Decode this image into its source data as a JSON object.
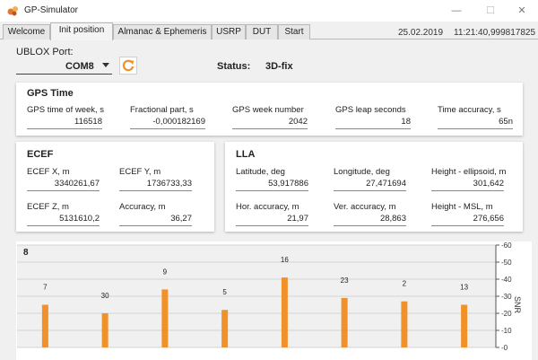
{
  "window": {
    "title": "GP-Simulator",
    "minimize": "—",
    "maximize": "☐",
    "close": "✕"
  },
  "tabs": [
    {
      "label": "Welcome",
      "active": false
    },
    {
      "label": "Init position",
      "active": true
    },
    {
      "label": "Almanac & Ephemeris",
      "active": false
    },
    {
      "label": "USRP",
      "active": false
    },
    {
      "label": "DUT",
      "active": false
    },
    {
      "label": "Start",
      "active": false
    }
  ],
  "clock": {
    "date": "25.02.2019",
    "time": "11:21:40,999817825"
  },
  "ublox": {
    "label": "UBLOX Port:",
    "port": "COM8",
    "refresh_icon": "refresh-icon",
    "accent": "#f0912a"
  },
  "status": {
    "label": "Status:",
    "value": "3D-fix"
  },
  "gps_time": {
    "title": "GPS Time",
    "fields": [
      {
        "label": "GPS time of week, s",
        "value": "116518"
      },
      {
        "label": "Fractional part, s",
        "value": "-0,000182169"
      },
      {
        "label": "GPS week number",
        "value": "2042"
      },
      {
        "label": "GPS leap seconds",
        "value": "18"
      },
      {
        "label": "Time accuracy, s",
        "value": "65n"
      }
    ]
  },
  "ecef": {
    "title": "ECEF",
    "fields": [
      {
        "label": "ECEF X, m",
        "value": "3340261,67"
      },
      {
        "label": "ECEF Y, m",
        "value": "1736733,33"
      },
      {
        "label": "ECEF Z, m",
        "value": "5131610,2"
      },
      {
        "label": "Accuracy, m",
        "value": "36,27"
      }
    ]
  },
  "lla": {
    "title": "LLA",
    "fields": [
      {
        "label": "Latitude, deg",
        "value": "53,917886"
      },
      {
        "label": "Longitude, deg",
        "value": "27,471694"
      },
      {
        "label": "Height - ellipsoid, m",
        "value": "301,642"
      },
      {
        "label": "Hor. accuracy, m",
        "value": "21,97"
      },
      {
        "label": "Ver. accuracy, m",
        "value": "28,863"
      },
      {
        "label": "Height - MSL, m",
        "value": "276,656"
      }
    ]
  },
  "chart_data": {
    "type": "bar",
    "title": "8",
    "ylabel": "SNR",
    "ylim": [
      0,
      60
    ],
    "yticks": [
      0,
      10,
      20,
      30,
      40,
      50,
      60
    ],
    "categories": [
      "7",
      "30",
      "9",
      "5",
      "16",
      "23",
      "2",
      "13"
    ],
    "values": [
      25,
      20,
      34,
      22,
      41,
      29,
      27,
      25
    ],
    "grid": true,
    "bar_color": "#f0912a"
  }
}
